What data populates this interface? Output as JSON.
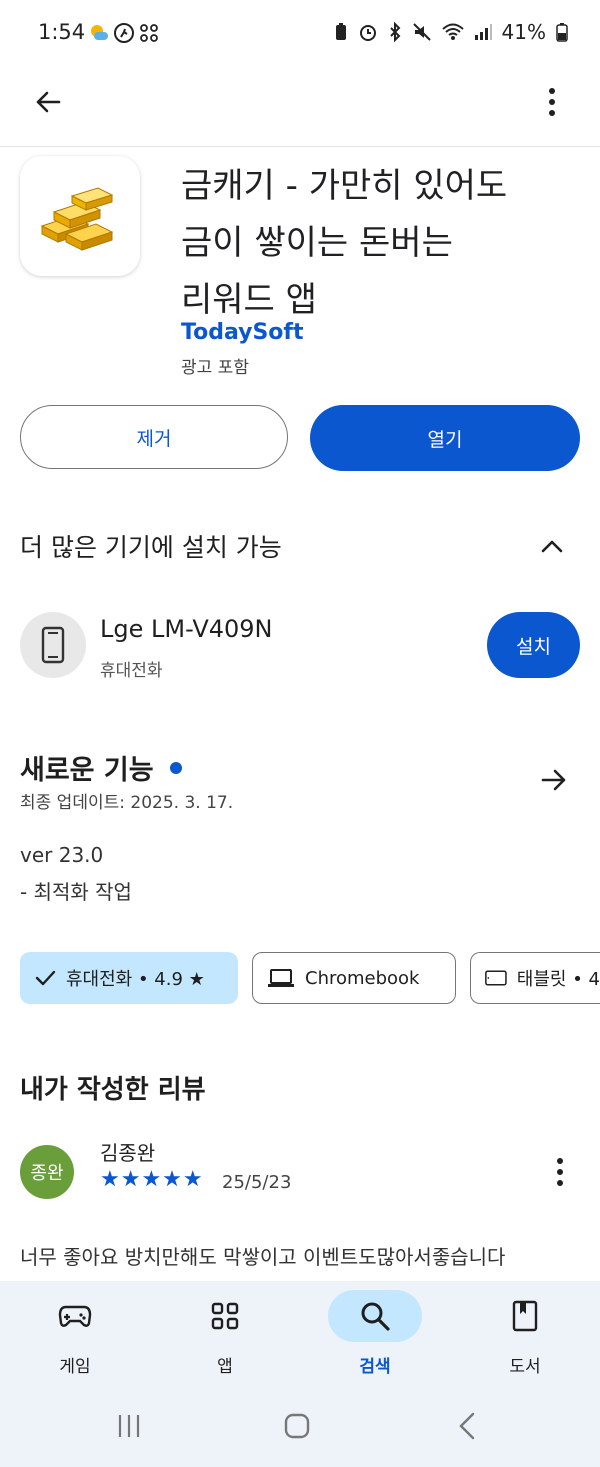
{
  "status_bar": {
    "time": "1:54",
    "battery": "41%"
  },
  "app": {
    "title_lines": [
      "금캐기 - 가만히 있어도",
      "금이 쌓이는 돈버는",
      "리워드 앱"
    ],
    "developer": "TodaySoft",
    "ads_label": "광고 포함",
    "uninstall_label": "제거",
    "open_label": "열기"
  },
  "devices": {
    "heading": "더 많은 기기에 설치 가능",
    "device_name": "Lge LM-V409N",
    "device_type": "휴대전화",
    "install_label": "설치"
  },
  "whats_new": {
    "heading": "새로운 기능",
    "updated": "최종 업데이트: 2025. 3. 17.",
    "version": "ver 23.0",
    "note": "- 최적화 작업"
  },
  "chips": [
    {
      "label": "휴대전화 • 4.9 ★",
      "selected": true
    },
    {
      "label": "Chromebook",
      "selected": false
    },
    {
      "label": "태블릿 • 4",
      "selected": false
    }
  ],
  "review": {
    "heading": "내가 작성한 리뷰",
    "avatar_text": "종완",
    "author": "김종완",
    "stars": "★★★★★",
    "rating": 5,
    "date": "25/5/23",
    "text": "너무 좋아요 방치만해도 막쌓이고 이벤트도많아서좋습니다"
  },
  "bottom_nav": [
    {
      "label": "게임",
      "icon": "gamepad-icon",
      "active": false
    },
    {
      "label": "앱",
      "icon": "apps-grid-icon",
      "active": false
    },
    {
      "label": "검색",
      "icon": "search-icon",
      "active": true
    },
    {
      "label": "도서",
      "icon": "book-icon",
      "active": false
    }
  ],
  "colors": {
    "accent": "#0b57d0",
    "chip_selected": "#c2e7ff",
    "nav_bg": "#eef3fa"
  }
}
